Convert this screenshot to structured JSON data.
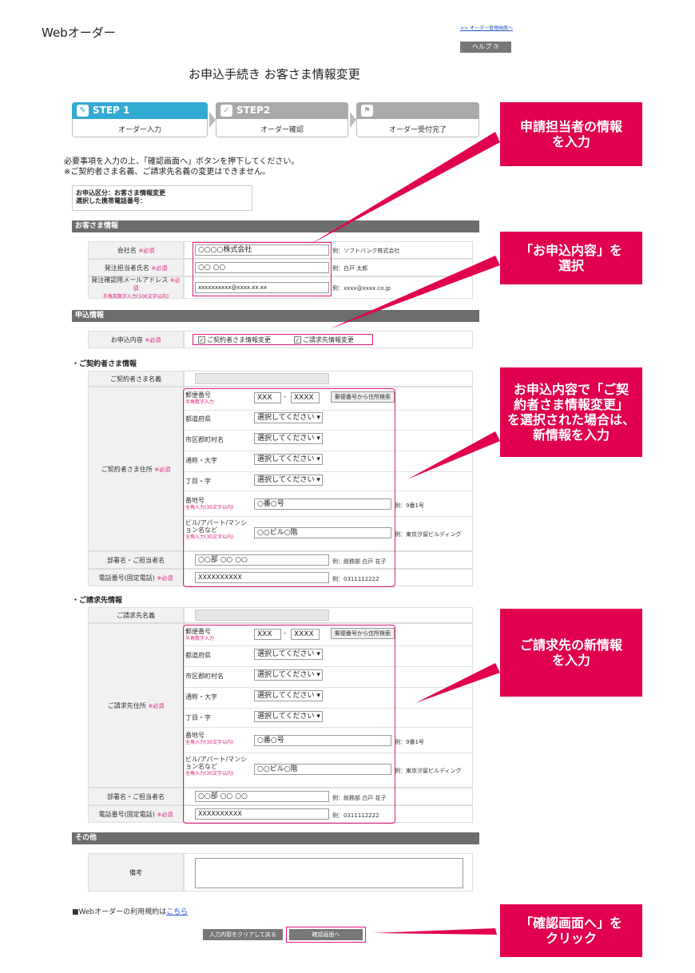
{
  "app_title": "Webオーダー",
  "mgmt_link": ">> オーダー管理画面へ",
  "help_label": "ヘルプ ⑦",
  "page_title": "お申込手続き お客さま情報変更",
  "steps": [
    {
      "title": "STEP 1",
      "sub": "オーダー入力"
    },
    {
      "title": "STEP2",
      "sub": "オーダー確認"
    },
    {
      "title": "",
      "sub": "オーダー受付完了"
    }
  ],
  "instructions": [
    "必要事項を入力の上、「確認画面へ」ボタンを押下してください。",
    "※ご契約者さま名義、ご請求先名義の変更はできません。"
  ],
  "order_info": [
    "お申込区分：お客さま情報変更",
    "選択した携帯電話番号："
  ],
  "required": "※必須",
  "customer": {
    "header": "お客さま情報",
    "company_label": "会社名",
    "company_value": "○○○○株式会社",
    "company_example": "例：ソフトバンク株式会社",
    "person_label": "発注担当者氏名",
    "person_value": "○○ ○○",
    "person_example": "例：白戸 太郎",
    "email_label": "発注確認用メールアドレス",
    "email_note": "半角英数字入力(100文字以内)",
    "email_value": "xxxxxxxxxx@xxxx.xx.xx",
    "email_example": "例：xxxx@xxxx.co.jp"
  },
  "application": {
    "header": "申込情報",
    "content_label": "お申込内容",
    "check1": "ご契約者さま情報変更",
    "check2": "ご請求先情報変更"
  },
  "contractor": {
    "header": "・ご契約者さま情報",
    "name_label": "ご契約者さま名義",
    "address_label": "ご契約者さま住所",
    "dept_label": "部署名・ご担当者名",
    "dept_value": "○○部 ○○ ○○",
    "dept_example": "例：総務部 白戸 花子",
    "phone_label": "電話番号(固定電話)",
    "phone_value": "XXXXXXXXXX",
    "phone_example": "例：0311112222"
  },
  "billing": {
    "header": "・ご請求先情報",
    "name_label": "ご請求先名義",
    "address_label": "ご請求先住所",
    "dept_label": "部署名・ご担当者名",
    "dept_value": "○○部 ○○ ○○",
    "dept_example": "例：総務部 白戸 花子",
    "phone_label": "電話番号(固定電話)",
    "phone_value": "XXXXXXXXXX",
    "phone_example": "例：0311112222"
  },
  "address": {
    "postal_label": "郵便番号",
    "postal_note": "半角数字入力",
    "postal1": "XXX",
    "postal_dash": "-",
    "postal2": "XXXX",
    "postal_search": "郵便番号から住所検索",
    "pref_label": "都道府県",
    "city_label": "市区郡町村名",
    "town_label": "通称・大字",
    "chome_label": "丁目・字",
    "select_value": "選択してください ▾",
    "banchi_label": "番地号",
    "banchi_note": "全角入力(30文字以内)",
    "banchi_value": "○番○号",
    "banchi_example": "例：9番1号",
    "bldg_label1": "ビル/アパート/マンシ",
    "bldg_label2": "ョン名など",
    "bldg_note": "全角入力(30文字以内)",
    "bldg_value": "○○ビル○階",
    "bldg_example": "例：東京汐留ビルディング"
  },
  "other": {
    "header": "その他",
    "remarks_label": "備考"
  },
  "terms_text": "■Webオーダーの利用規約は",
  "terms_link": "こちら",
  "clear_button": "入力内容をクリアして戻る",
  "confirm_button": "確認画面へ",
  "callouts": {
    "c1": [
      "申請担当者の情報",
      "を入力"
    ],
    "c2": [
      "「お申込内容」を",
      "選択"
    ],
    "c3": [
      "お申込内容で「ご契",
      "約者さま情報変更」",
      "を選択された場合は、",
      "新情報を入力"
    ],
    "c4": [
      "ご請求先の新情報",
      "を入力"
    ],
    "c5": [
      "「確認画面へ」を",
      "クリック"
    ]
  },
  "colors": {
    "accent": "#33aad4",
    "callout": "#e0004f",
    "section": "#6d6d6d"
  }
}
